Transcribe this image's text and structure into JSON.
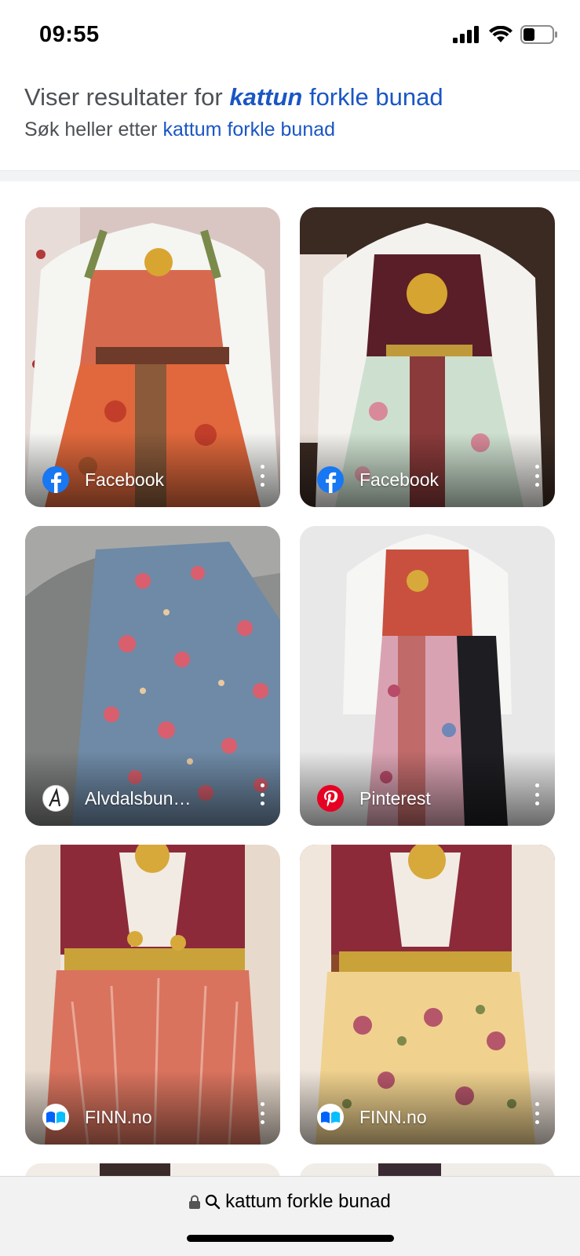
{
  "status_bar": {
    "time": "09:55",
    "battery_level": 0.4
  },
  "correction": {
    "showing_prefix": "Viser resultater for",
    "corrected_word": "kattun",
    "corrected_rest": "forkle bunad",
    "instead_prefix": "Søk heller etter",
    "original_query": "kattum forkle bunad"
  },
  "results": [
    {
      "source": "Facebook",
      "icon": "facebook-icon"
    },
    {
      "source": "Facebook",
      "icon": "facebook-icon"
    },
    {
      "source": "Alvdalsbun…",
      "icon": "alvdalsbunad-logo-icon"
    },
    {
      "source": "Pinterest",
      "icon": "pinterest-icon"
    },
    {
      "source": "FINN.no",
      "icon": "finn-icon"
    },
    {
      "source": "FINN.no",
      "icon": "finn-icon"
    }
  ],
  "address_bar": {
    "url_text": "kattum forkle bunad",
    "lock_icon": "lock-icon",
    "search_icon": "search-icon"
  },
  "colors": {
    "link": "#1a56c4",
    "facebook": "#1877f2",
    "pinterest": "#e60023",
    "finn": "#0063fb"
  }
}
